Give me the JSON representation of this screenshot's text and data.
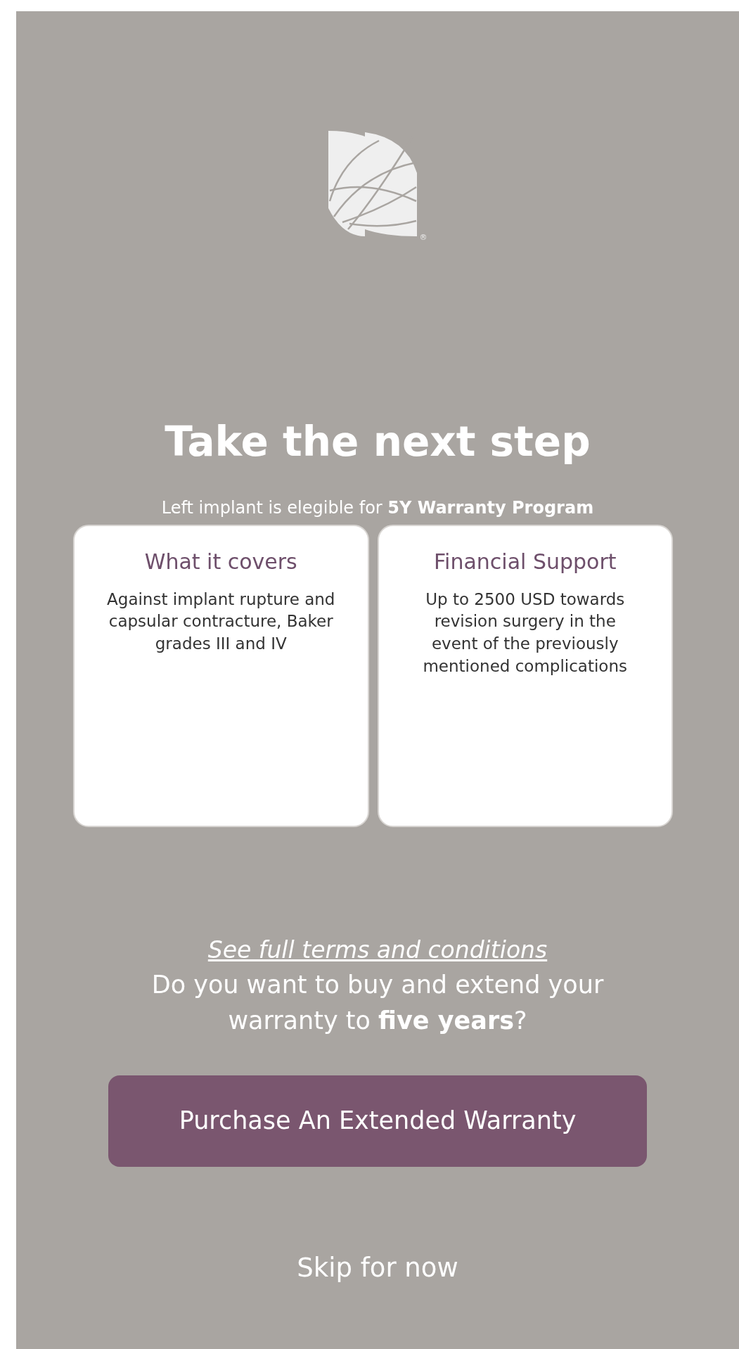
{
  "logo": {
    "registered_mark": "®"
  },
  "heading": "Take the next step",
  "subtitle": "Left implant is elegible for **5Y Warranty Program**",
  "cards": [
    {
      "title": "What it covers",
      "body": "Against implant rupture and capsular contracture, Baker grades III and IV"
    },
    {
      "title": "Financial Support",
      "body": "Up to 2500 USD towards revision surgery in the event of the previously mentioned complications"
    }
  ],
  "terms_link": "See full terms and conditions",
  "question": "Do you want to buy and extend your warranty to **five years**?",
  "primary_button": "Purchase An Extended Warranty",
  "skip_link": "Skip for now"
}
